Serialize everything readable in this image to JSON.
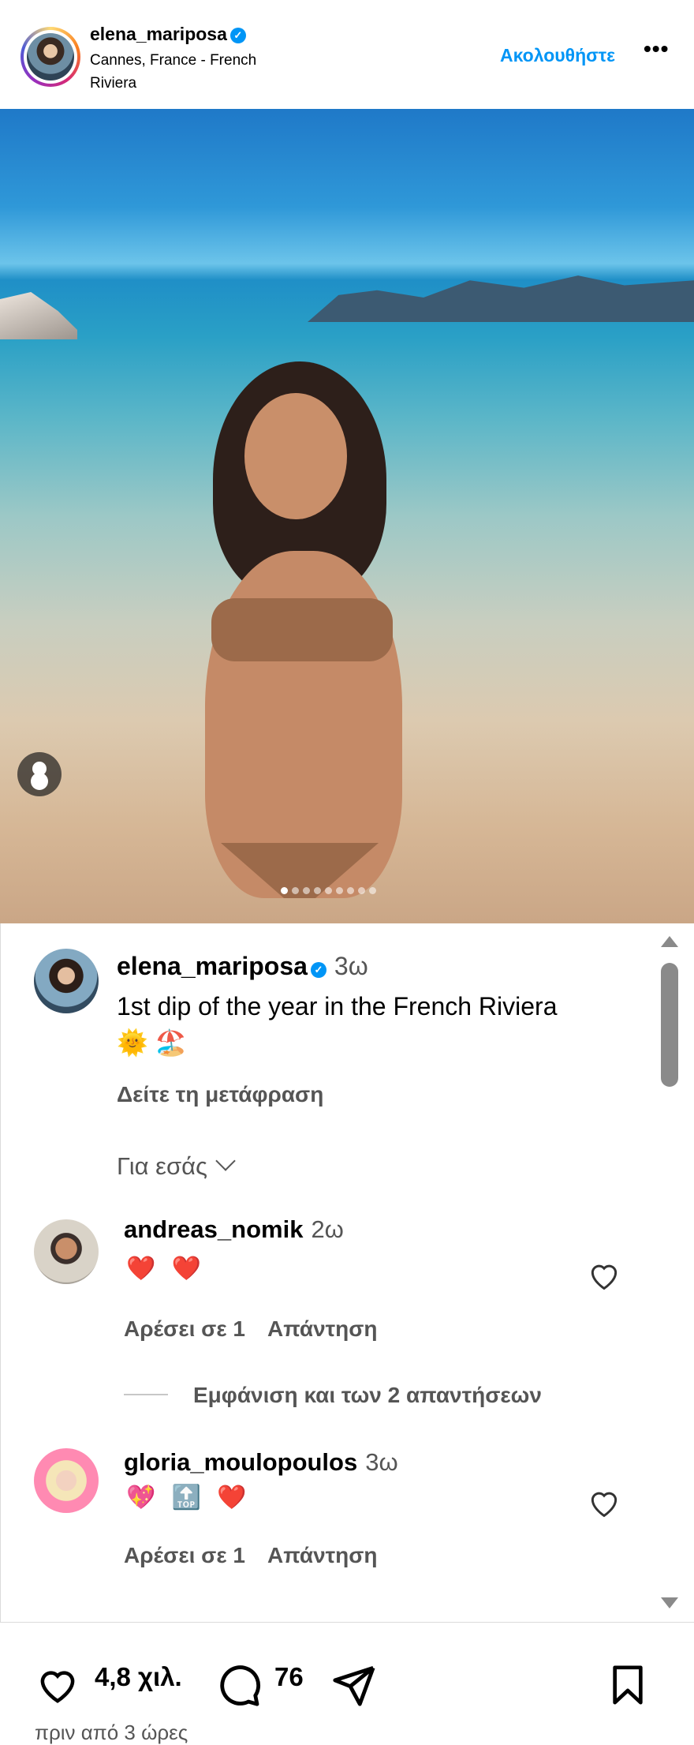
{
  "header": {
    "username": "elena_mariposa",
    "location": "Cannes, France - French Riviera",
    "follow_label": "Ακολουθήστε",
    "more_label": "•••"
  },
  "carousel": {
    "total_slides": 9,
    "active_slide": 1
  },
  "caption": {
    "username": "elena_mariposa",
    "time": "3ω",
    "text": "1st dip of the year in the French Riviera",
    "emojis": "🌞 🏖️",
    "translate_label": "Δείτε τη μετάφραση"
  },
  "sort_label": "Για εσάς",
  "comments": [
    {
      "username": "andreas_nomik",
      "time": "2ω",
      "text": "❤️ ❤️",
      "likes_label": "Αρέσει σε 1",
      "reply_label": "Απάντηση",
      "view_replies_label": "Εμφάνιση και των 2 απαντήσεων"
    },
    {
      "username": "gloria_moulopoulos",
      "time": "3ω",
      "text": "💖 🔝 ❤️",
      "likes_label": "Αρέσει σε 1",
      "reply_label": "Απάντηση"
    }
  ],
  "actions": {
    "likes_count": "4,8 χιλ.",
    "comments_count": "76",
    "timestamp": "πριν από 3 ώρες"
  },
  "colors": {
    "accent": "#0095f6",
    "verified": "#0095f6",
    "heart": "#ed4956"
  }
}
